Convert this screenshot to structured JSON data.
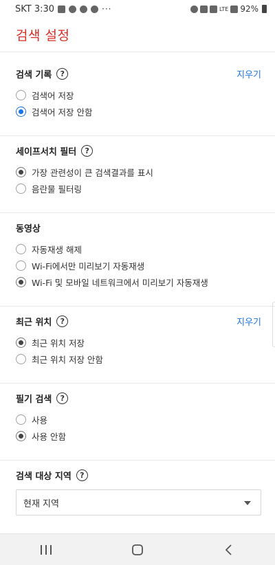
{
  "status_bar": {
    "carrier_time": "SKT 3:30",
    "more": "···",
    "network": "LTE",
    "battery": "92%",
    "icons": [
      "image-icon",
      "chat-icon",
      "talk-icon",
      "ring-icon",
      "alarm-icon",
      "bluetooth-icon",
      "mute-icon",
      "signal-icon",
      "battery-icon"
    ]
  },
  "header": {
    "title": "검색 설정"
  },
  "sections": {
    "history": {
      "title": "검색 기록",
      "clear": "지우기",
      "options": [
        "검색어 저장",
        "검색어 저장 안함"
      ],
      "selected_index": 1
    },
    "safesearch": {
      "title": "세이프서치 필터",
      "options": [
        "가장 관련성이 큰 검색결과를 표시",
        "음란물 필터링"
      ],
      "selected_index": 0
    },
    "video": {
      "title": "동영상",
      "options": [
        "자동재생 해제",
        "Wi-Fi에서만 미리보기 자동재생",
        "Wi-Fi 및 모바일 네트워크에서 미리보기 자동재생"
      ],
      "selected_index": 2
    },
    "location": {
      "title": "최근 위치",
      "clear": "지우기",
      "options": [
        "최근 위치 저장",
        "최근 위치 저장 안함"
      ],
      "selected_index": 0
    },
    "handwriting": {
      "title": "필기 검색",
      "options": [
        "사용",
        "사용 안함"
      ],
      "selected_index": 1
    },
    "region": {
      "title": "검색 대상 지역",
      "value": "현재 지역"
    }
  },
  "help_symbol": "?",
  "colors": {
    "accent_red": "#d93025",
    "link_blue": "#1a73e8",
    "selected_radio_blue": "#1a73e8"
  }
}
